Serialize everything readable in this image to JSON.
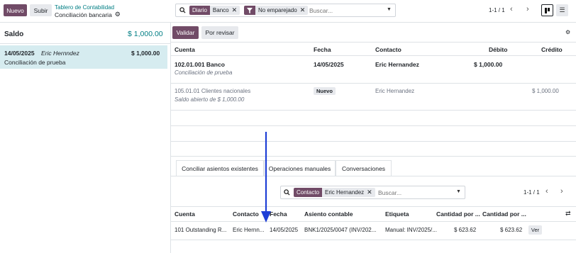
{
  "topbar": {
    "new_label": "Nuevo",
    "upload_label": "Subir",
    "breadcrumb_parent": "Tablero de Contabilidad",
    "breadcrumb_current": "Conciliación bancaria",
    "search": {
      "facet1_label": "Diario",
      "facet1_value": "Banco",
      "facet2_value": "No emparejado",
      "placeholder": "Buscar..."
    },
    "pager": "1-1 / 1"
  },
  "left_panel": {
    "balance_label": "Saldo",
    "balance_value": "$ 1,000.00",
    "line": {
      "date": "14/05/2025",
      "partner": "Eric Hernndez",
      "amount": "$ 1,000.00",
      "label": "Conciliación de prueba"
    }
  },
  "right_panel": {
    "validate_label": "Validar",
    "to_check_label": "Por revisar",
    "columns": {
      "account": "Cuenta",
      "date": "Fecha",
      "partner": "Contacto",
      "debit": "Débito",
      "credit": "Crédito"
    },
    "rows": [
      {
        "account": "102.01.001 Banco",
        "label": "Conciliación de prueba",
        "date": "14/05/2025",
        "partner": "Eric Hernandez",
        "debit": "$ 1,000.00",
        "credit": ""
      },
      {
        "account": "105.01.01 Clientes nacionales",
        "label": "Saldo abierto de $ 1,000.00",
        "badge": "Nuevo",
        "partner": "Eric Hernandez",
        "debit": "",
        "credit": "$ 1,000.00"
      }
    ],
    "tabs": [
      "Conciliar asientos existentes",
      "Operaciones manuales",
      "Conversaciones"
    ],
    "sub_search": {
      "facet_label": "Contacto",
      "facet_value": "Eric Hernandez",
      "placeholder": "Buscar..."
    },
    "sub_pager": "1-1 / 1",
    "sub_columns": {
      "account": "Cuenta",
      "partner": "Contacto",
      "date": "Fecha",
      "move": "Asiento contable",
      "label": "Etiqueta",
      "amount": "Cantidad por ...",
      "amount2": "Cantidad por ..."
    },
    "sub_row": {
      "account": "101 Outstanding R...",
      "partner": "Eric Hernn...",
      "date": "14/05/2025",
      "move": "BNK1/2025/0047 (INV/202...",
      "label": "Manual: INV/2025/...",
      "amount": "$ 623.62",
      "amount2": "$ 623.62",
      "view_label": "Ver"
    }
  },
  "colors": {
    "primary": "#714b67",
    "teal": "#017e84",
    "selected_row": "#d6ecf0",
    "arrow": "#1f3fd6"
  }
}
